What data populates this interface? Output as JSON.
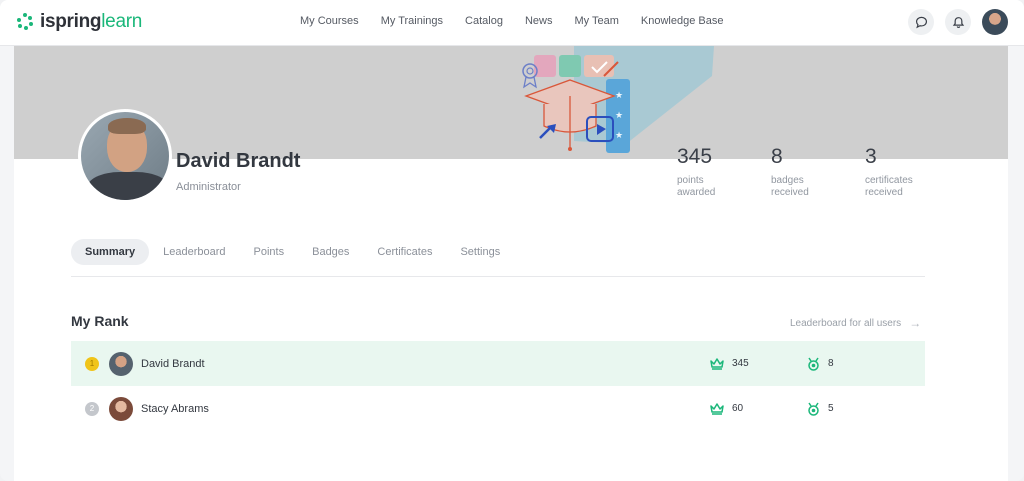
{
  "header": {
    "logo_ispring": "ispring",
    "logo_learn": "learn",
    "nav": [
      "My Courses",
      "My Trainings",
      "Catalog",
      "News",
      "My Team",
      "Knowledge Base"
    ]
  },
  "colors": {
    "brand": "#1bb77a",
    "banner": "#cfcfcf",
    "highlight_row": "#e9f7f0",
    "gold": "#f0c419"
  },
  "icons": {
    "chat": "chat-bubble-icon",
    "notifications": "bell-icon",
    "points": "crown-icon",
    "badges": "medal-icon",
    "link_arrow": "arrow-right-icon"
  },
  "profile": {
    "name": "David Brandt",
    "role": "Administrator"
  },
  "stats": [
    {
      "value": "345",
      "line1": "points",
      "line2": "awarded"
    },
    {
      "value": "8",
      "line1": "badges",
      "line2": "received"
    },
    {
      "value": "3",
      "line1": "certificates",
      "line2": "received"
    }
  ],
  "tabs": [
    "Summary",
    "Leaderboard",
    "Points",
    "Badges",
    "Certificates",
    "Settings"
  ],
  "rank": {
    "title": "My Rank",
    "leaderboard_link": "Leaderboard for all users",
    "rows": [
      {
        "position": "1",
        "name": "David Brandt",
        "points": "345",
        "badges": "8"
      },
      {
        "position": "2",
        "name": "Stacy Abrams",
        "points": "60",
        "badges": "5"
      }
    ]
  }
}
